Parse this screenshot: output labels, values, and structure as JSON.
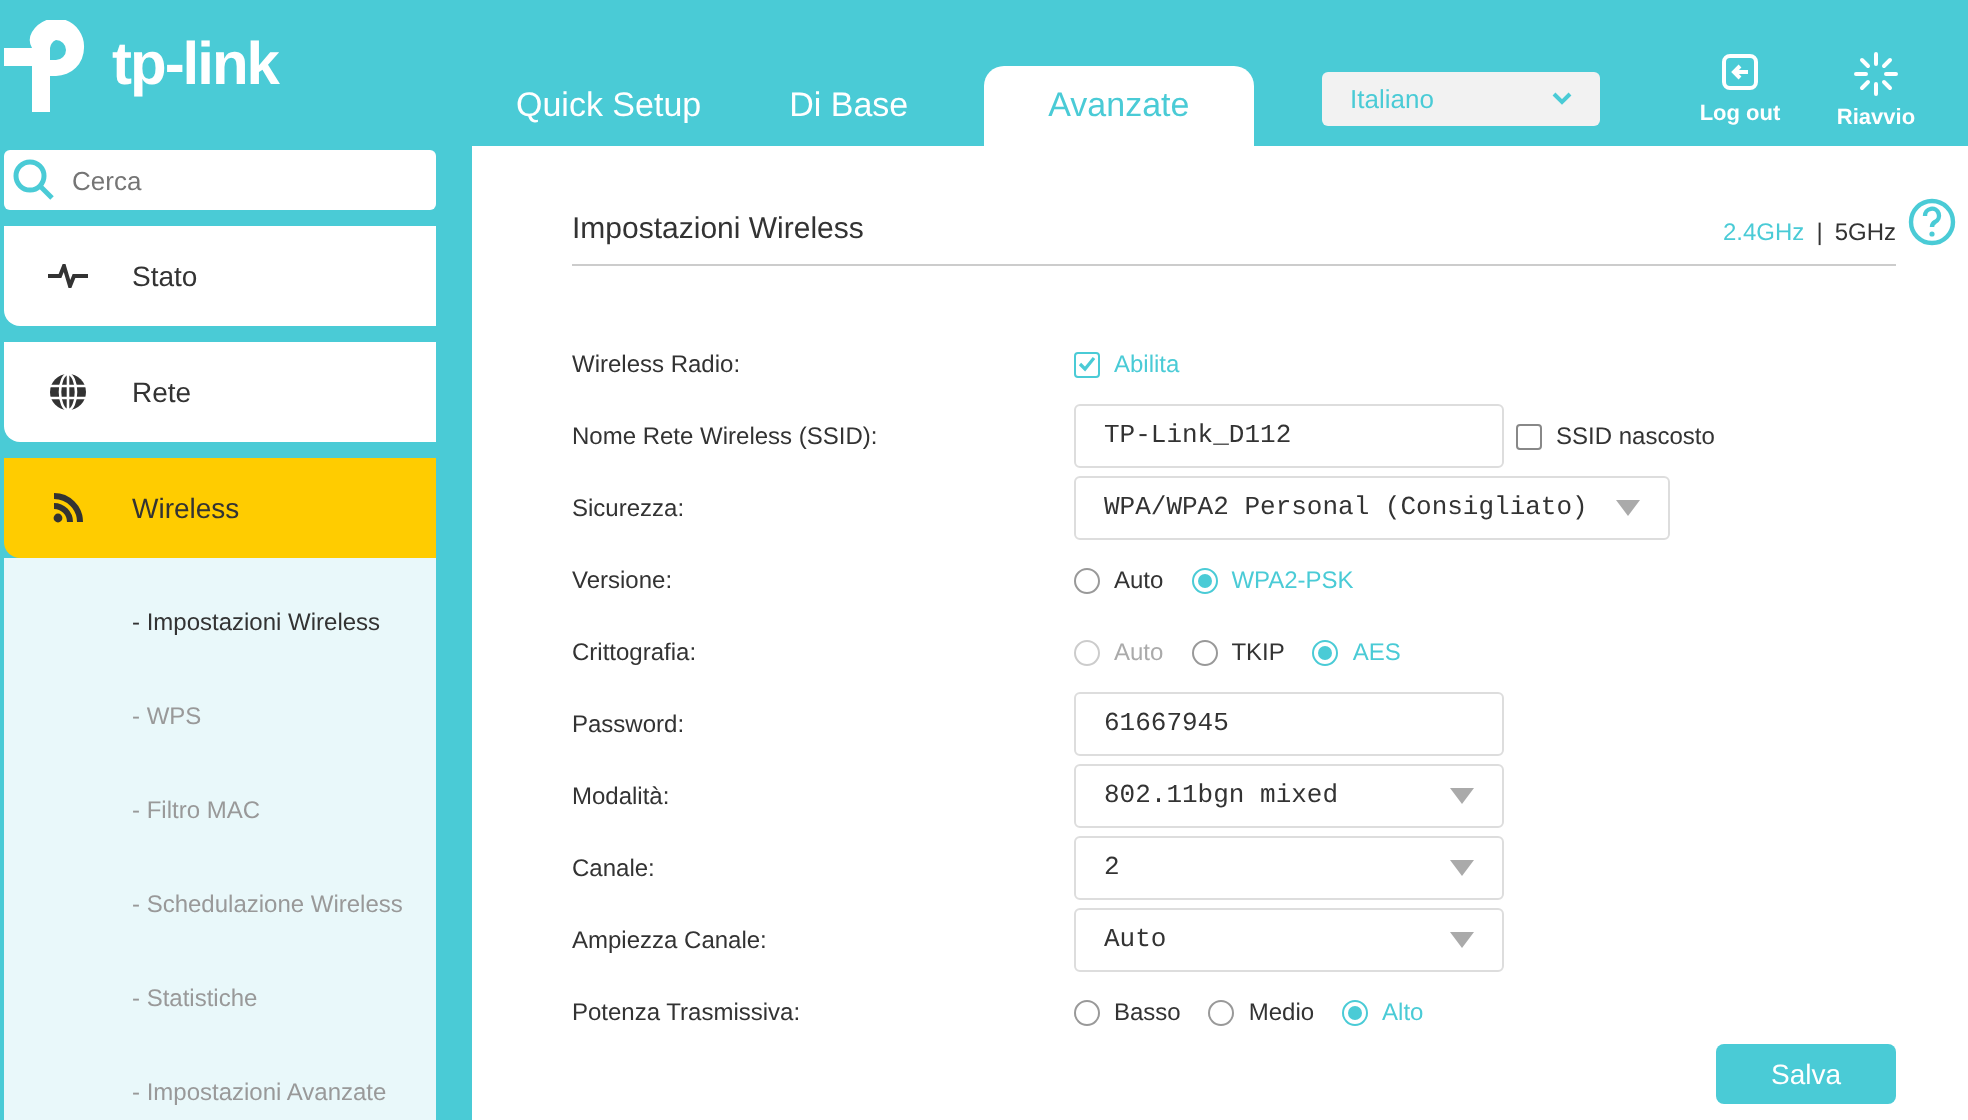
{
  "header": {
    "logo": "tp-link",
    "tabs": [
      {
        "label": "Quick Setup",
        "selected": false
      },
      {
        "label": "Di Base",
        "selected": false
      },
      {
        "label": "Avanzate",
        "selected": true
      }
    ],
    "language": {
      "value": "Italiano"
    },
    "actions": [
      {
        "label": "Log out",
        "kind": "logout"
      },
      {
        "label": "Riavvio",
        "kind": "reboot"
      }
    ]
  },
  "sidebar": {
    "search": {
      "placeholder": "Cerca"
    },
    "items": [
      {
        "label": "Stato",
        "kind": "pulse",
        "selected": false
      },
      {
        "label": "Rete",
        "kind": "globe",
        "selected": false
      },
      {
        "label": "Wireless",
        "kind": "wifi",
        "selected": true,
        "children": [
          {
            "label": "- Impostazioni Wireless",
            "selected": true
          },
          {
            "label": "- WPS",
            "selected": false
          },
          {
            "label": "- Filtro MAC",
            "selected": false
          },
          {
            "label": "- Schedulazione Wireless",
            "selected": false
          },
          {
            "label": "- Statistiche",
            "selected": false
          },
          {
            "label": "- Impostazioni Avanzate",
            "selected": false
          }
        ]
      }
    ]
  },
  "main": {
    "title": "Impostazioni Wireless",
    "bands": [
      {
        "label": "2.4GHz",
        "selected": true
      },
      {
        "label": "5GHz",
        "selected": false
      }
    ],
    "separator": "|",
    "rows": [
      {
        "label": "Wireless Radio:",
        "kind": "checkbox",
        "options": [
          {
            "label": "Abilita",
            "checked": true
          }
        ]
      },
      {
        "label": "Nome Rete Wireless (SSID):",
        "kind": "text",
        "value": "TP-Link_D112",
        "extra": {
          "label": "SSID nascosto",
          "checked": false
        }
      },
      {
        "label": "Sicurezza:",
        "kind": "select",
        "wide": true,
        "value": "WPA/WPA2 Personal (Consigliato)"
      },
      {
        "label": "Versione:",
        "kind": "radio",
        "options": [
          {
            "label": "Auto",
            "selected": false,
            "disabled": false
          },
          {
            "label": "WPA2-PSK",
            "selected": true,
            "disabled": false
          }
        ]
      },
      {
        "label": "Crittografia:",
        "kind": "radio",
        "options": [
          {
            "label": "Auto",
            "selected": false,
            "disabled": true
          },
          {
            "label": "TKIP",
            "selected": false,
            "disabled": false
          },
          {
            "label": "AES",
            "selected": true,
            "disabled": false
          }
        ]
      },
      {
        "label": "Password:",
        "kind": "text",
        "value": "61667945"
      },
      {
        "label": "Modalità:",
        "kind": "select",
        "value": "802.11bgn mixed"
      },
      {
        "label": "Canale:",
        "kind": "select",
        "value": "2"
      },
      {
        "label": "Ampiezza Canale:",
        "kind": "select",
        "value": "Auto"
      },
      {
        "label": "Potenza Trasmissiva:",
        "kind": "radio",
        "options": [
          {
            "label": "Basso",
            "selected": false,
            "disabled": false
          },
          {
            "label": "Medio",
            "selected": false,
            "disabled": false
          },
          {
            "label": "Alto",
            "selected": true,
            "disabled": false
          }
        ]
      }
    ],
    "save": "Salva"
  }
}
